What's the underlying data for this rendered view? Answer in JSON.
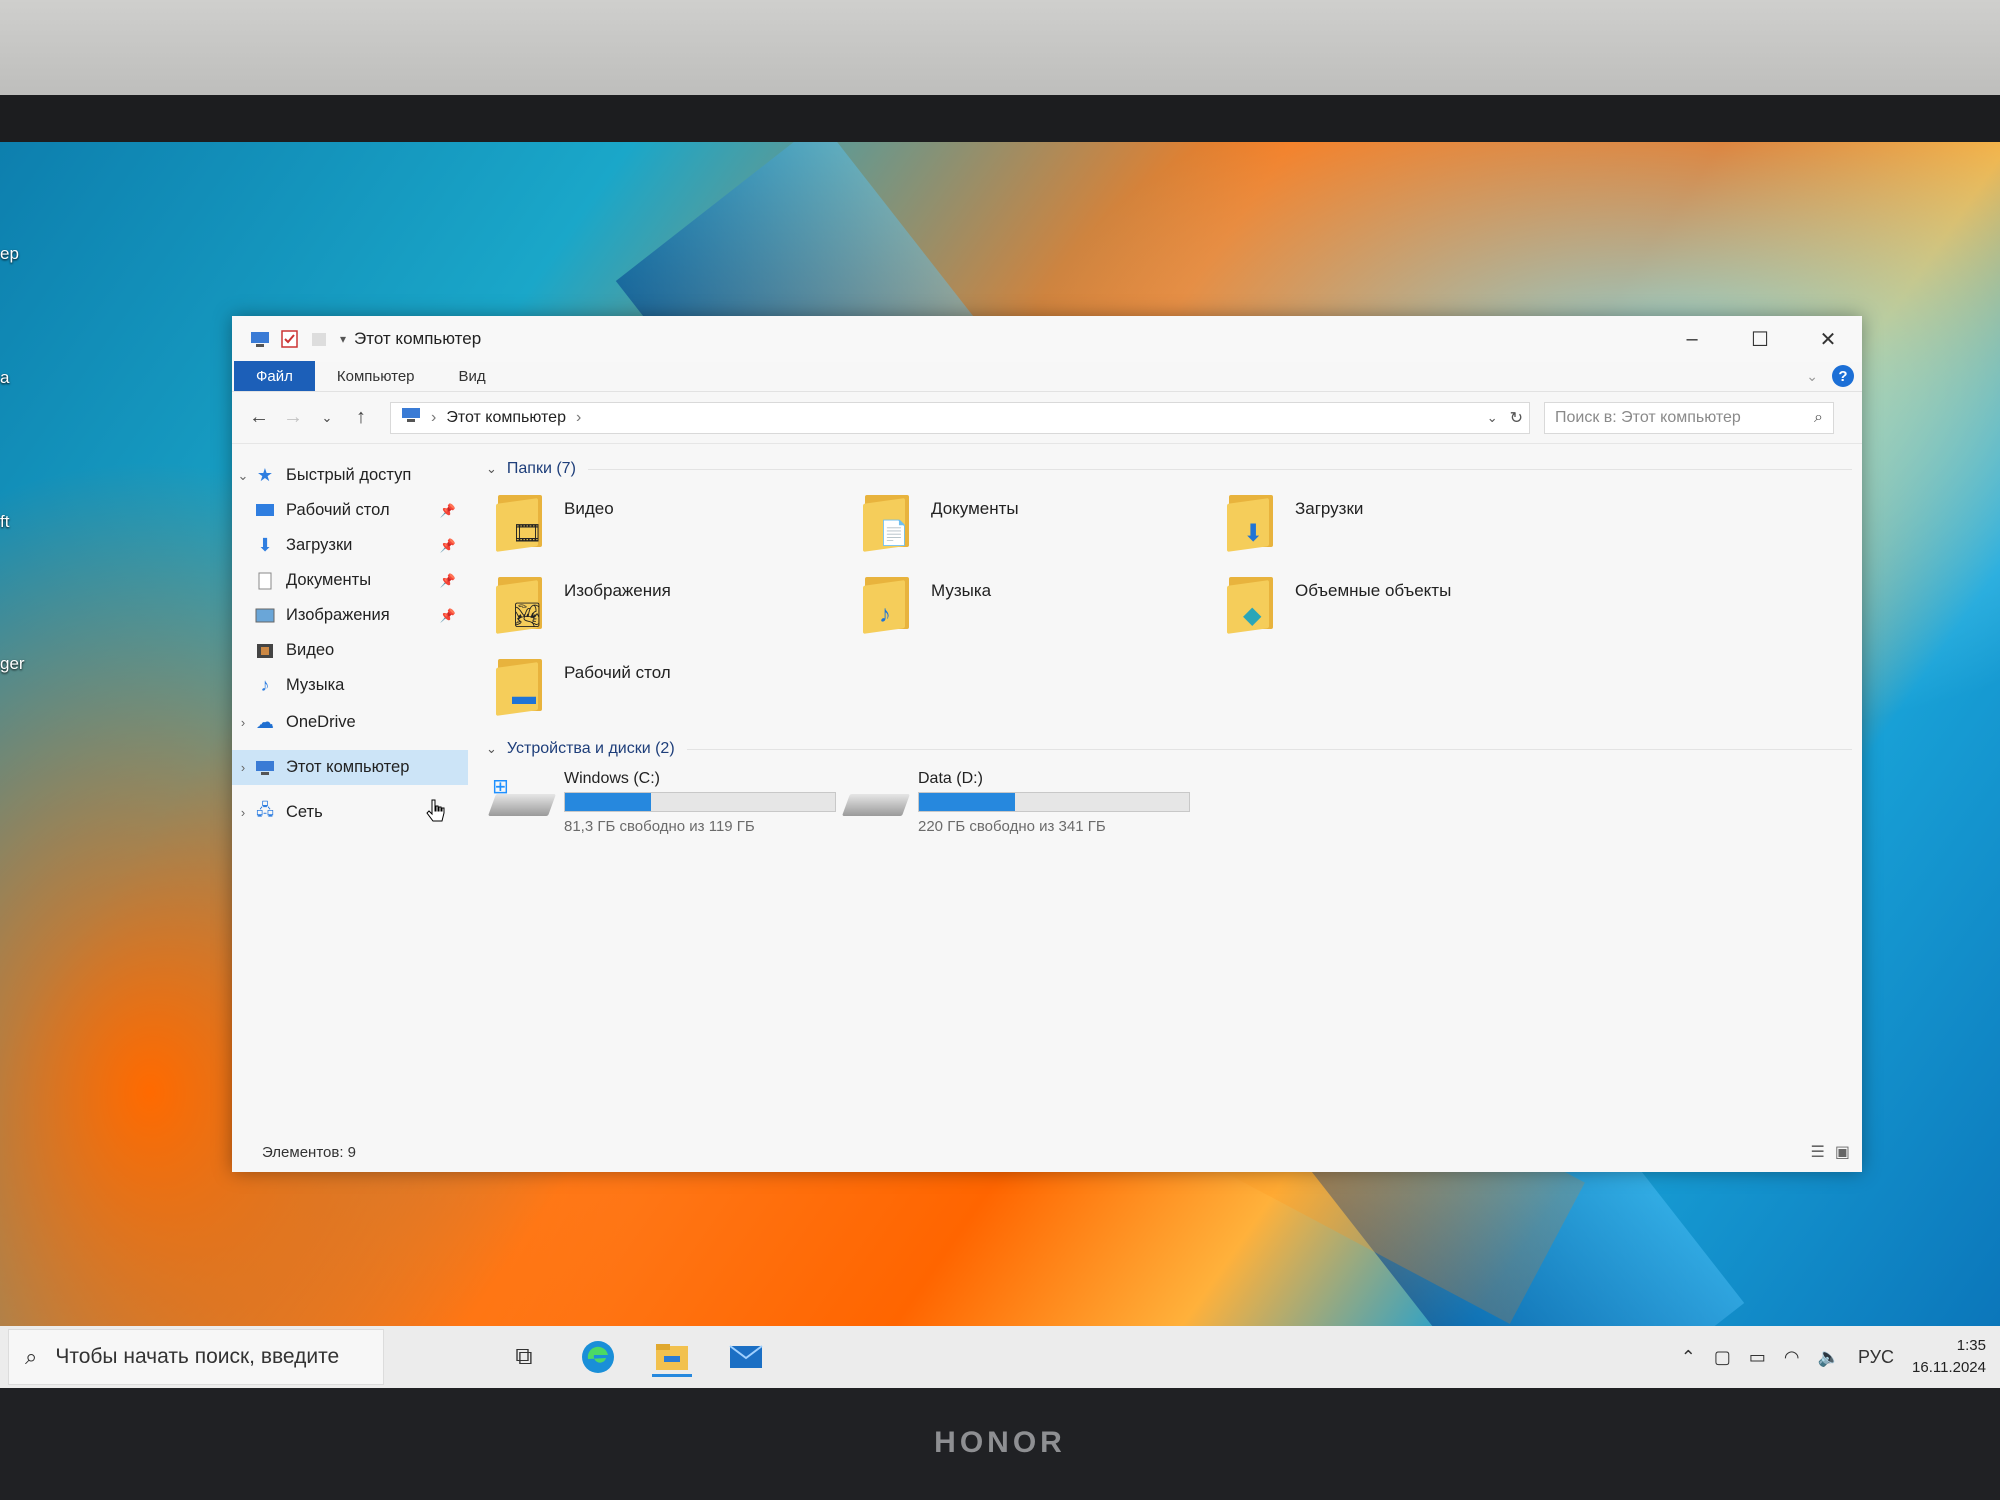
{
  "window": {
    "title": "Этот компьютер",
    "ribbon_tabs": [
      {
        "label": "Файл",
        "active": true
      },
      {
        "label": "Компьютер",
        "active": false
      },
      {
        "label": "Вид",
        "active": false
      }
    ],
    "help_label": "?",
    "controls": {
      "minimize": "–",
      "maximize": "☐",
      "close": "✕"
    }
  },
  "address": {
    "path": "Этот компьютер",
    "search_placeholder": "Поиск в: Этот компьютер"
  },
  "nav": {
    "quick_access": "Быстрый доступ",
    "quick_items": [
      {
        "label": "Рабочий стол",
        "pinned": true,
        "icon": "desktop-icon"
      },
      {
        "label": "Загрузки",
        "pinned": true,
        "icon": "download-icon"
      },
      {
        "label": "Документы",
        "pinned": true,
        "icon": "document-icon"
      },
      {
        "label": "Изображения",
        "pinned": true,
        "icon": "image-icon"
      },
      {
        "label": "Видео",
        "pinned": false,
        "icon": "video-icon"
      },
      {
        "label": "Музыка",
        "pinned": false,
        "icon": "music-icon"
      }
    ],
    "onedrive": "OneDrive",
    "this_pc": "Этот компьютер",
    "network": "Сеть"
  },
  "content": {
    "folders_header": "Папки (7)",
    "folders": [
      {
        "name": "Видео",
        "icon": "video-folder-icon"
      },
      {
        "name": "Документы",
        "icon": "documents-folder-icon"
      },
      {
        "name": "Загрузки",
        "icon": "downloads-folder-icon"
      },
      {
        "name": "Изображения",
        "icon": "pictures-folder-icon"
      },
      {
        "name": "Музыка",
        "icon": "music-folder-icon"
      },
      {
        "name": "Объемные объекты",
        "icon": "3d-objects-folder-icon"
      },
      {
        "name": "Рабочий стол",
        "icon": "desktop-folder-icon"
      }
    ],
    "devices_header": "Устройства и диски (2)",
    "drives": [
      {
        "name": "Windows (C:)",
        "free": "81,3 ГБ свободно из 119 ГБ",
        "used_fraction": 0.317
      },
      {
        "name": "Data (D:)",
        "free": "220 ГБ свободно из 341 ГБ",
        "used_fraction": 0.355
      }
    ]
  },
  "status": {
    "items": "Элементов: 9"
  },
  "taskbar": {
    "search_placeholder": "Чтобы начать поиск, введите",
    "lang": "РУС",
    "time": "1:35",
    "date": "16.11.2024"
  },
  "desktop_labels": [
    "ер",
    "а",
    "ft",
    "ger"
  ],
  "brand": "HONOR",
  "colors": {
    "accent": "#1c5fb8",
    "drive_bar": "#2688de",
    "selection": "#cce4f7"
  }
}
